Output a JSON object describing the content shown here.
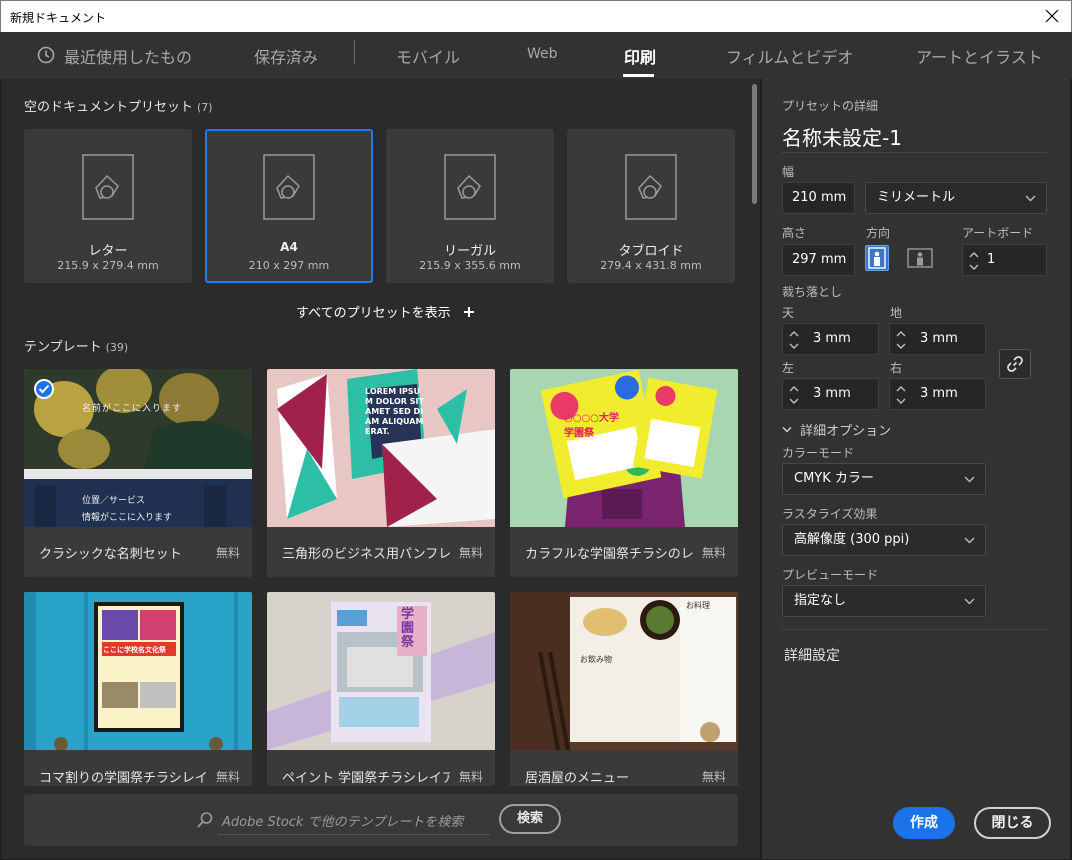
{
  "window": {
    "title": "新規ドキュメント"
  },
  "tabs": [
    {
      "label": "最近使用したもの"
    },
    {
      "label": "保存済み"
    },
    {
      "label": "モバイル"
    },
    {
      "label": "Web"
    },
    {
      "label": "印刷"
    },
    {
      "label": "フィルムとビデオ"
    },
    {
      "label": "アートとイラスト"
    }
  ],
  "blank_presets": {
    "title": "空のドキュメントプリセット",
    "count": "(7)",
    "items": [
      {
        "name": "レター",
        "size": "215.9 x 279.4 mm"
      },
      {
        "name": "A4",
        "size": "210 x 297 mm"
      },
      {
        "name": "リーガル",
        "size": "215.9 x 355.6 mm"
      },
      {
        "name": "タブロイド",
        "size": "279.4 x 431.8 mm"
      }
    ],
    "show_all": "すべてのプリセットを表示"
  },
  "templates": {
    "title": "テンプレート",
    "count": "(39)",
    "items": [
      {
        "name": "クラシックな名刺セット",
        "price": "無料",
        "thumb_text_1": "名前がここに入ります",
        "thumb_text_2": "位置／サービス",
        "thumb_text_3": "情報がここに入ります",
        "thumb_text_4": "入ります"
      },
      {
        "name": "三角形のビジネス用パンフレ...",
        "price": "無料",
        "thumb_text_1": "LOREM IPSUM DOLOR SIT AMET SED DIAM ALIQUAM ERAT."
      },
      {
        "name": "カラフルな学園祭チラシのレ...",
        "price": "無料",
        "thumb_text_1": "○○○○大学 学園祭"
      },
      {
        "name": "コマ割りの学園祭チラシレイ...",
        "price": "無料",
        "thumb_text_1": "ここに学校名文化祭"
      },
      {
        "name": "ペイント 学園祭チラシレイア...",
        "price": "無料",
        "thumb_text_1": "学園祭"
      },
      {
        "name": "居酒屋のメニュー",
        "price": "無料",
        "thumb_text_1": "お料理",
        "thumb_text_2": "お飲み物"
      }
    ]
  },
  "search": {
    "placeholder": "Adobe Stock で他のテンプレートを検索",
    "button": "検索"
  },
  "details": {
    "header": "プリセットの詳細",
    "doc_name": "名称未設定-1",
    "width_label": "幅",
    "width_value": "210 mm",
    "unit": "ミリメートル",
    "height_label": "高さ",
    "height_value": "297 mm",
    "orientation_label": "方向",
    "artboard_label": "アートボード",
    "artboard_value": "1",
    "bleed_label": "裁ち落とし",
    "bleed_top_label": "天",
    "bleed_top": "3 mm",
    "bleed_bottom_label": "地",
    "bleed_bottom": "3 mm",
    "bleed_left_label": "左",
    "bleed_left": "3 mm",
    "bleed_right_label": "右",
    "bleed_right": "3 mm",
    "advanced_label": "詳細オプション",
    "color_mode_label": "カラーモード",
    "color_mode": "CMYK カラー",
    "raster_label": "ラスタライズ効果",
    "raster": "高解像度 (300 ppi)",
    "preview_label": "プレビューモード",
    "preview": "指定なし",
    "more_settings": "詳細設定",
    "create": "作成",
    "close": "閉じる"
  },
  "colors": {
    "accent": "#1a73e8",
    "selected_border": "#1f7be8"
  }
}
